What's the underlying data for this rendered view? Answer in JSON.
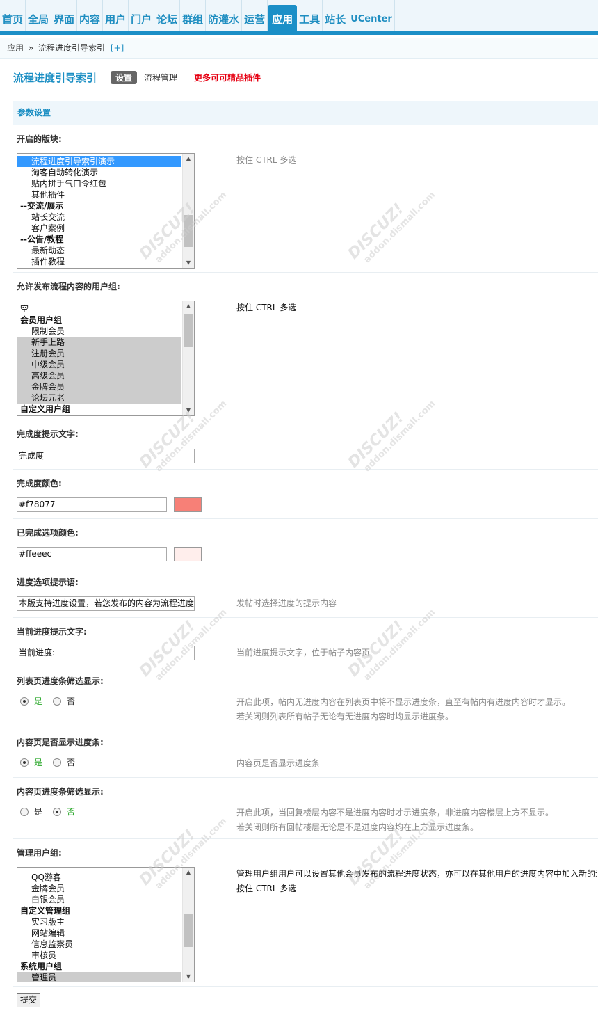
{
  "topnav": {
    "items": [
      "首页",
      "全局",
      "界面",
      "内容",
      "用户",
      "门户",
      "论坛",
      "群组",
      "防灌水",
      "运营",
      "应用",
      "工具",
      "站长",
      "UCenter"
    ],
    "active_index": 10
  },
  "breadcrumb": {
    "root": "应用",
    "separator": "»",
    "current": "流程进度引导索引",
    "add": "[+]"
  },
  "title": {
    "name": "流程进度引导索引",
    "tab_active": "设置",
    "tab_other": "流程管理",
    "promo": "更多可可精品插件"
  },
  "section": {
    "title": "参数设置"
  },
  "settings": {
    "forums": {
      "label": "开启的版块:",
      "tip": "按住 CTRL 多选",
      "options": [
        {
          "text": "流程进度引导索引演示",
          "kind": "sel"
        },
        {
          "text": "淘客自动转化演示",
          "kind": "opt"
        },
        {
          "text": "贴内拼手气口令红包",
          "kind": "opt"
        },
        {
          "text": "其他插件",
          "kind": "opt"
        },
        {
          "text": "--交流/展示",
          "kind": "grp"
        },
        {
          "text": "站长交流",
          "kind": "opt"
        },
        {
          "text": "客户案例",
          "kind": "opt"
        },
        {
          "text": "--公告/教程",
          "kind": "grp"
        },
        {
          "text": "最新动态",
          "kind": "opt"
        },
        {
          "text": "插件教程",
          "kind": "opt"
        }
      ]
    },
    "post_groups": {
      "label": "允许发布流程内容的用户组:",
      "tip": "按住 CTRL 多选",
      "options": [
        {
          "text": "空",
          "kind": "plain"
        },
        {
          "text": "会员用户组",
          "kind": "grp"
        },
        {
          "text": "限制会员",
          "kind": "opt"
        },
        {
          "text": "新手上路",
          "kind": "gray"
        },
        {
          "text": "注册会员",
          "kind": "gray"
        },
        {
          "text": "中级会员",
          "kind": "gray"
        },
        {
          "text": "高级会员",
          "kind": "gray"
        },
        {
          "text": "金牌会员",
          "kind": "gray"
        },
        {
          "text": "论坛元老",
          "kind": "gray"
        },
        {
          "text": "自定义用户组",
          "kind": "grp"
        }
      ]
    },
    "progress_text": {
      "label": "完成度提示文字:",
      "value": "完成度"
    },
    "progress_color": {
      "label": "完成度颜色:",
      "value": "#f78077",
      "swatch": "#f78077"
    },
    "done_color": {
      "label": "已完成选项颜色:",
      "value": "#ffeeec",
      "swatch": "#ffeeec"
    },
    "option_tip": {
      "label": "进度选项提示语:",
      "value": "本版支持进度设置，若您发布的内容为流程进度",
      "tip": "发帖时选择进度的提示内容"
    },
    "current_tip": {
      "label": "当前进度提示文字:",
      "value": "当前进度:",
      "tip": "当前进度提示文字，位于帖子内容页"
    },
    "list_filter": {
      "label": "列表页进度条筛选显示:",
      "yes": "是",
      "no": "否",
      "selected": "yes",
      "tip1": "开启此项，帖内无进度内容在列表页中将不显示进度条，直至有帖内有进度内容时才显示。",
      "tip2": "若关闭则列表所有帖子无论有无进度内容时均显示进度条。"
    },
    "content_show": {
      "label": "内容页是否显示进度条:",
      "yes": "是",
      "no": "否",
      "selected": "yes",
      "tip1": "内容页是否显示进度条"
    },
    "content_filter": {
      "label": "内容页进度条筛选显示:",
      "yes": "是",
      "no": "否",
      "selected": "no",
      "tip1": "开启此项，当回复楼层内容不是进度内容时才示进度条，非进度内容楼层上方不显示。",
      "tip2": "若关闭则所有回帖楼层无论是不是进度内容均在上方显示进度条。"
    },
    "admin_groups": {
      "label": "管理用户组:",
      "tip1": "管理用户组用户可以设置其他会员发布的流程进度状态，亦可以在其他用户的进度内容中加入新的进",
      "tip2": "按住 CTRL 多选",
      "options": [
        {
          "text": "QQ游客",
          "kind": "opt"
        },
        {
          "text": "金牌会员",
          "kind": "opt"
        },
        {
          "text": "白银会员",
          "kind": "opt"
        },
        {
          "text": "自定义管理组",
          "kind": "grp"
        },
        {
          "text": "实习版主",
          "kind": "opt"
        },
        {
          "text": "网站编辑",
          "kind": "opt"
        },
        {
          "text": "信息监察员",
          "kind": "opt"
        },
        {
          "text": "审核员",
          "kind": "opt"
        },
        {
          "text": "系统用户组",
          "kind": "grp"
        },
        {
          "text": "管理员",
          "kind": "gray"
        }
      ]
    }
  },
  "submit_label": "提交",
  "colors": {
    "accent": "#1b8fc7",
    "promo": "#e60012",
    "selected_option": "#3399ff"
  }
}
